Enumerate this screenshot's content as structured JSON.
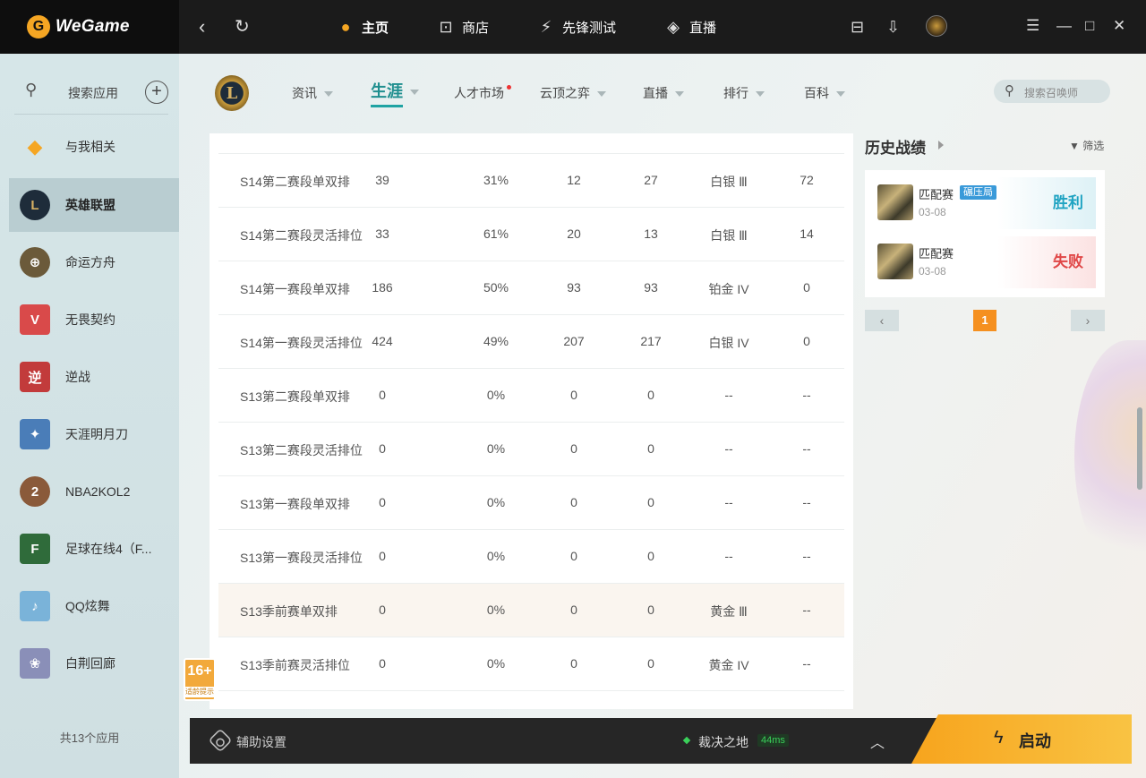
{
  "brand": {
    "name": "WeGame"
  },
  "topnav": [
    {
      "label": "主页",
      "icon": "pacman-icon"
    },
    {
      "label": "商店",
      "icon": "shop-bag-icon"
    },
    {
      "label": "先锋测试",
      "icon": "pioneer-icon"
    },
    {
      "label": "直播",
      "icon": "live-icon"
    }
  ],
  "sidebar": {
    "search_label": "搜索应用",
    "items": [
      {
        "label": "与我相关",
        "color": "#f5a623"
      },
      {
        "label": "英雄联盟",
        "color": "#1e2c3a"
      },
      {
        "label": "命运方舟",
        "color": "#6b5a3a"
      },
      {
        "label": "无畏契约",
        "color": "#d94a4a"
      },
      {
        "label": "逆战",
        "color": "#c23b3b"
      },
      {
        "label": "天涯明月刀",
        "color": "#4a7db8"
      },
      {
        "label": "NBA2KOL2",
        "color": "#8a5a3a"
      },
      {
        "label": "足球在线4（F...",
        "color": "#2f6b3a"
      },
      {
        "label": "QQ炫舞",
        "color": "#7ab3d9"
      },
      {
        "label": "白荆回廊",
        "color": "#8a8fb8"
      }
    ],
    "count": "共13个应用"
  },
  "age_badge": {
    "rating": "16+",
    "note": "适龄提示"
  },
  "game_logo": "L",
  "game_tabs": [
    "资讯",
    "生涯",
    "人才市场",
    "云顶之弈",
    "直播",
    "排行",
    "百科"
  ],
  "summoner_search_placeholder": "搜索召唤师",
  "table": {
    "rows": [
      [
        "S14第二赛段单双排",
        "39",
        "31%",
        "12",
        "27",
        "白银 Ⅲ",
        "72"
      ],
      [
        "S14第二赛段灵活排位",
        "33",
        "61%",
        "20",
        "13",
        "白银 Ⅲ",
        "14"
      ],
      [
        "S14第一赛段单双排",
        "186",
        "50%",
        "93",
        "93",
        "铂金 IV",
        "0"
      ],
      [
        "S14第一赛段灵活排位",
        "424",
        "49%",
        "207",
        "217",
        "白银 IV",
        "0"
      ],
      [
        "S13第二赛段单双排",
        "0",
        "0%",
        "0",
        "0",
        "--",
        "--"
      ],
      [
        "S13第二赛段灵活排位",
        "0",
        "0%",
        "0",
        "0",
        "--",
        "--"
      ],
      [
        "S13第一赛段单双排",
        "0",
        "0%",
        "0",
        "0",
        "--",
        "--"
      ],
      [
        "S13第一赛段灵活排位",
        "0",
        "0%",
        "0",
        "0",
        "--",
        "--"
      ],
      [
        "S13季前赛单双排",
        "0",
        "0%",
        "0",
        "0",
        "黄金 Ⅲ",
        "--"
      ],
      [
        "S13季前赛灵活排位",
        "0",
        "0%",
        "0",
        "0",
        "黄金 IV",
        "--"
      ]
    ]
  },
  "history": {
    "title": "历史战绩",
    "filter_label": "筛选",
    "matches": [
      {
        "mode": "匹配赛",
        "tag": "碾压局",
        "date": "03-08",
        "result": "胜利"
      },
      {
        "mode": "匹配赛",
        "tag": "",
        "date": "03-08",
        "result": "失败"
      }
    ],
    "current_page": "1"
  },
  "bottom": {
    "assist_label": "辅助设置",
    "server": "裁决之地",
    "ping": "44ms",
    "launch_label": "启动"
  }
}
